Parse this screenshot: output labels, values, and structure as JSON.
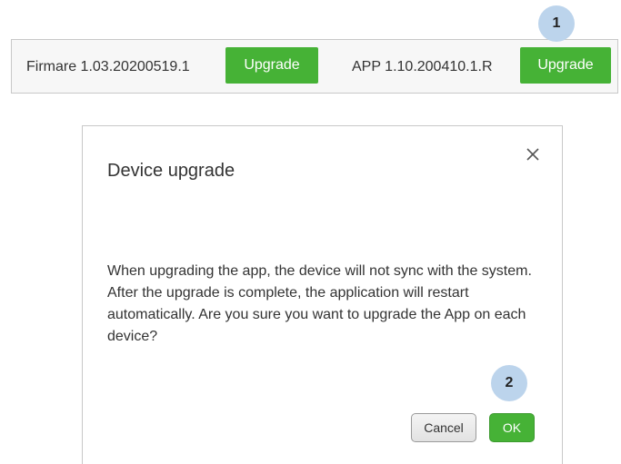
{
  "version_bar": {
    "firmware_label": "Firmare 1.03.20200519.1",
    "firmware_button": "Upgrade",
    "app_label": "APP 1.10.200410.1.R",
    "app_button": "Upgrade"
  },
  "markers": {
    "step1": "1",
    "step2": "2"
  },
  "dialog": {
    "title": "Device upgrade",
    "close_icon": "close-icon",
    "message": "When upgrading the app, the device will not sync with the system. After the upgrade is complete, the application will restart automatically. Are you sure you want to upgrade the App on each device?",
    "cancel_label": "Cancel",
    "ok_label": "OK"
  },
  "colors": {
    "accent_green": "#46b236",
    "marker_blue": "#bcd4ec"
  }
}
